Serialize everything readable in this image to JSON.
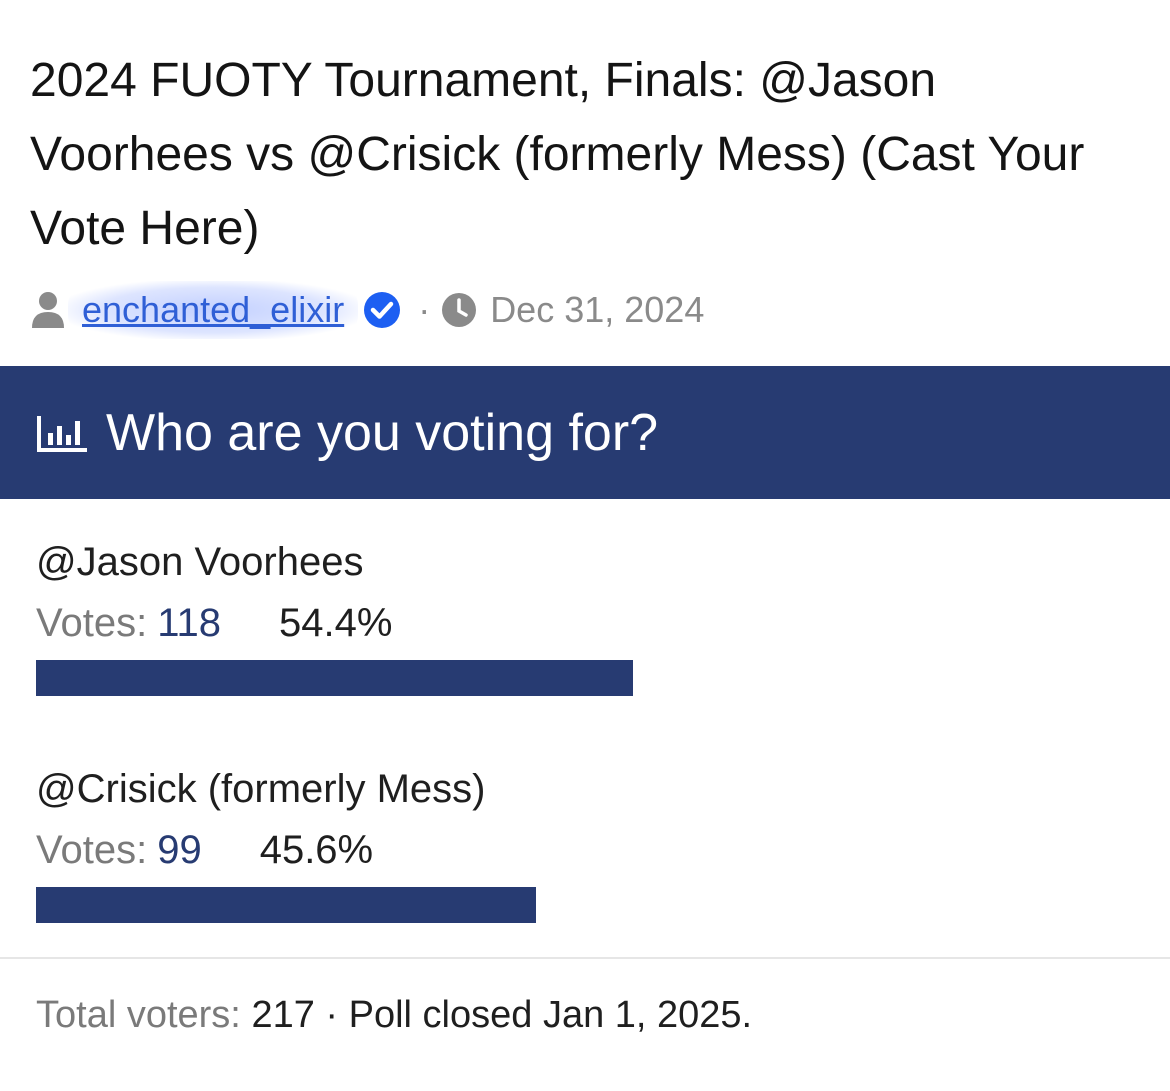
{
  "thread": {
    "title": "2024 FUOTY Tournament, Finals: @Jason Voorhees vs @Crisick (formerly Mess) (Cast Your Vote Here)",
    "author": "enchanted_elixir",
    "separator": "·",
    "date": "Dec 31, 2024"
  },
  "icons": {
    "author": "user-icon",
    "verified": "verified-check-icon",
    "time": "clock-icon",
    "poll": "bar-chart-icon"
  },
  "colors": {
    "accent": "#273b72",
    "link": "#2f5fd6"
  },
  "poll": {
    "question": "Who are you voting for?",
    "votes_label": "Votes:",
    "options": [
      {
        "name": "@Jason Voorhees",
        "votes": "118",
        "percent": "54.4%",
        "fraction": 0.544
      },
      {
        "name": "@Crisick (formerly Mess)",
        "votes": "99",
        "percent": "45.6%",
        "fraction": 0.456
      }
    ],
    "footer": {
      "total_label": "Total voters:",
      "total_value": "217",
      "separator": "·",
      "status": "Poll closed Jan 1, 2025."
    }
  }
}
